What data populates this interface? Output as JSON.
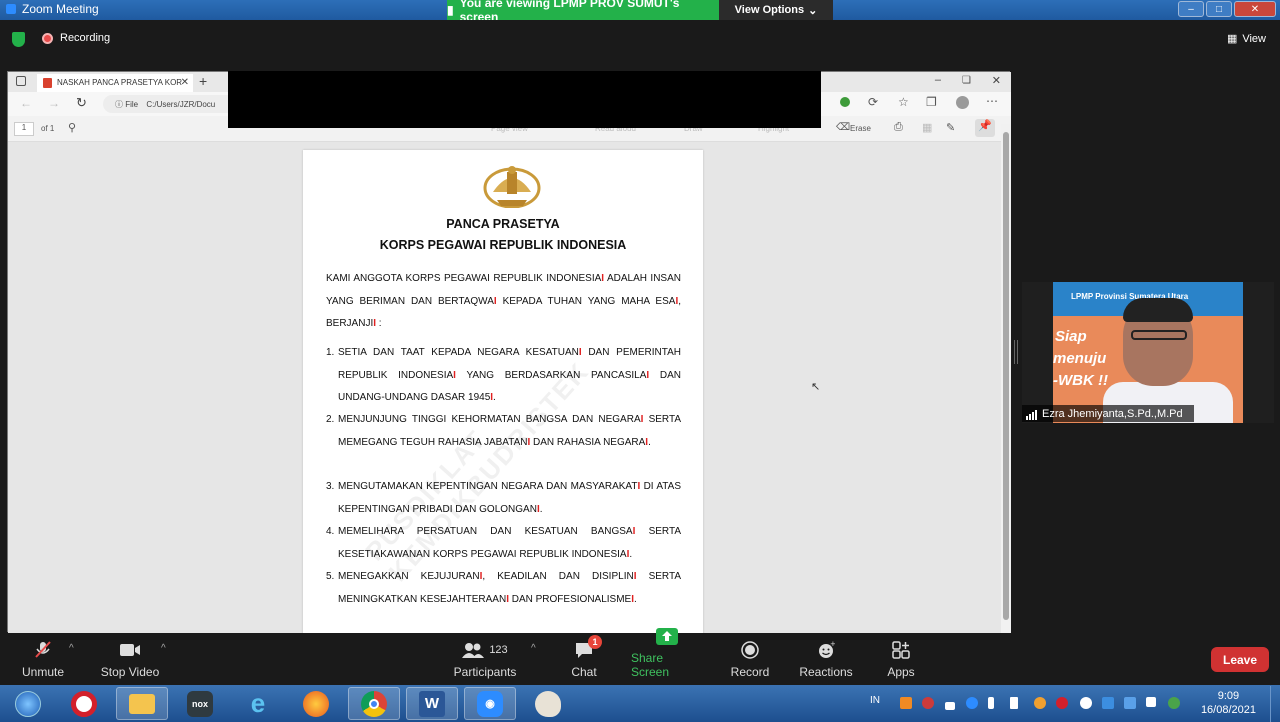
{
  "window": {
    "title": "Zoom Meeting"
  },
  "share_banner": {
    "text": "You are viewing LPMP PROV SUMUT's screen",
    "view_options": "View Options"
  },
  "meeting": {
    "recording": "Recording",
    "view": "View"
  },
  "browser": {
    "tab_title": "NASKAH PANCA PRASETYA KOR",
    "address_prefix": "File",
    "address": "C:/Users/JZR/Docu",
    "page_number": "1",
    "page_of": "of 1",
    "tools": [
      "Page view",
      "Read aloud",
      "Draw",
      "Highlight",
      "Erase"
    ]
  },
  "document": {
    "title_line1": "PANCA PRASETYA",
    "title_line2": "KORPS PEGAWAI REPUBLIK INDONESIA",
    "intro_a": "KAMI ANGGOTA KORPS PEGAWAI REPUBLIK INDONESIA",
    "intro_b": " ADALAH INSAN YANG BERIMAN DAN BERTAQWA",
    "intro_c": " KEPADA TUHAN YANG MAHA ESA",
    "intro_d": ", BERJANJI",
    "intro_e": " :",
    "marker": "I",
    "items": [
      {
        "num": "1.",
        "a": "SETIA DAN TAAT KEPADA NEGARA KESATUAN",
        "b": " DAN PEMERINTAH REPUBLIK INDONESIA",
        "c": " YANG BERDASARKAN PANCASILA",
        "d": " DAN UNDANG-UNDANG DASAR 1945",
        "e": "."
      },
      {
        "num": "2.",
        "a": "MENJUNJUNG TINGGI KEHORMATAN BANGSA DAN NEGARA",
        "b": " SERTA MEMEGANG TEGUH RAHASIA JABATAN",
        "c": " DAN RAHASIA NEGARA",
        "e": "."
      },
      {
        "num": "3.",
        "a": "MENGUTAMAKAN KEPENTINGAN NEGARA DAN MASYARAKAT",
        "b": " DI ATAS KEPENTINGAN PRIBADI DAN GOLONGAN",
        "e": "."
      },
      {
        "num": "4.",
        "a": "MEMELIHARA PERSATUAN DAN KESATUAN BANGSA",
        "b": " SERTA KESETIAKAWANAN KORPS PEGAWAI REPUBLIK INDONESIA",
        "e": "."
      },
      {
        "num": "5.",
        "a": "MENEGAKKAN KEJUJURAN",
        "b": ", KEADILAN DAN DISIPLIN",
        "c": " SERTA MENINGKATKAN KESEJAHTERAAN",
        "d": " DAN PROFESIONALISME",
        "e": "."
      }
    ]
  },
  "video": {
    "participant_name": "Ezra Jhemiyanta,S.Pd.,M.Pd",
    "banner_text": "LPMP Provinsi Sumatera Utara",
    "slogan": [
      "Siap",
      "menuju",
      "-WBK !!"
    ]
  },
  "toolbar": {
    "unmute": "Unmute",
    "stop_video": "Stop Video",
    "participants": "Participants",
    "participants_count": "123",
    "chat": "Chat",
    "chat_badge": "1",
    "share_screen": "Share Screen",
    "record": "Record",
    "reactions": "Reactions",
    "apps": "Apps",
    "leave": "Leave"
  },
  "taskbar": {
    "lang": "IN",
    "time": "9:09",
    "date": "16/08/2021"
  }
}
